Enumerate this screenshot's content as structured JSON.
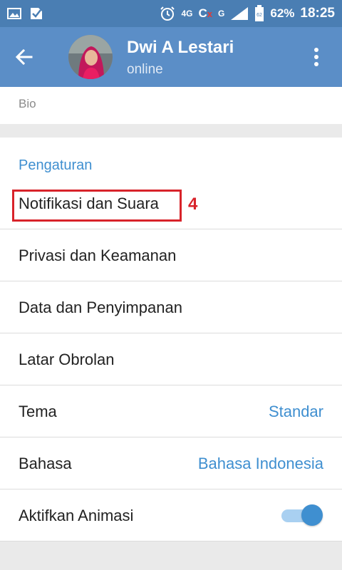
{
  "status_bar": {
    "network": "4G",
    "carrier_mark": "C",
    "carrier_x": "x",
    "signal_type": "G",
    "battery_level": "62",
    "battery_text": "62%",
    "time": "18:25"
  },
  "header": {
    "title": "Dwi A Lestari",
    "subtitle": "online"
  },
  "bio": {
    "label": "Bio"
  },
  "settings": {
    "section_title": "Pengaturan",
    "items": [
      {
        "label": "Notifikasi dan Suara",
        "value": ""
      },
      {
        "label": "Privasi dan Keamanan",
        "value": ""
      },
      {
        "label": "Data dan Penyimpanan",
        "value": ""
      },
      {
        "label": "Latar Obrolan",
        "value": ""
      },
      {
        "label": "Tema",
        "value": "Standar"
      },
      {
        "label": "Bahasa",
        "value": "Bahasa Indonesia"
      },
      {
        "label": "Aktifkan Animasi",
        "value": "",
        "toggle": true
      }
    ],
    "annotation": {
      "step": "4",
      "color": "#d8232a"
    }
  },
  "colors": {
    "status_bar": "#4a7eb3",
    "app_bar": "#5b8ec7",
    "accent": "#3f8fd0"
  }
}
